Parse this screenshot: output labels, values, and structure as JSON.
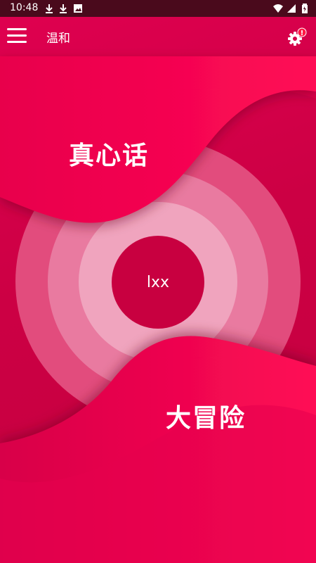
{
  "status_bar": {
    "time": "10:48",
    "icons": [
      "download-icon",
      "download-icon",
      "image-icon",
      "wifi-icon",
      "signal-icon",
      "battery-icon"
    ]
  },
  "app_bar": {
    "title": "温和",
    "menu_icon": "hamburger-menu-icon",
    "settings_icon": "gear-icon",
    "settings_badge": "!"
  },
  "game": {
    "truth_label": "真心话",
    "dare_label": "大冒险",
    "center_label": "lxx"
  },
  "colors": {
    "background": "#cc0044",
    "wave": "#f0004f",
    "center": "#c80040",
    "ring_outer": "#e24c7d",
    "ring_middle": "#e97aa0",
    "ring_inner": "#f0a4be",
    "status_bar": "#4a0a1c"
  }
}
